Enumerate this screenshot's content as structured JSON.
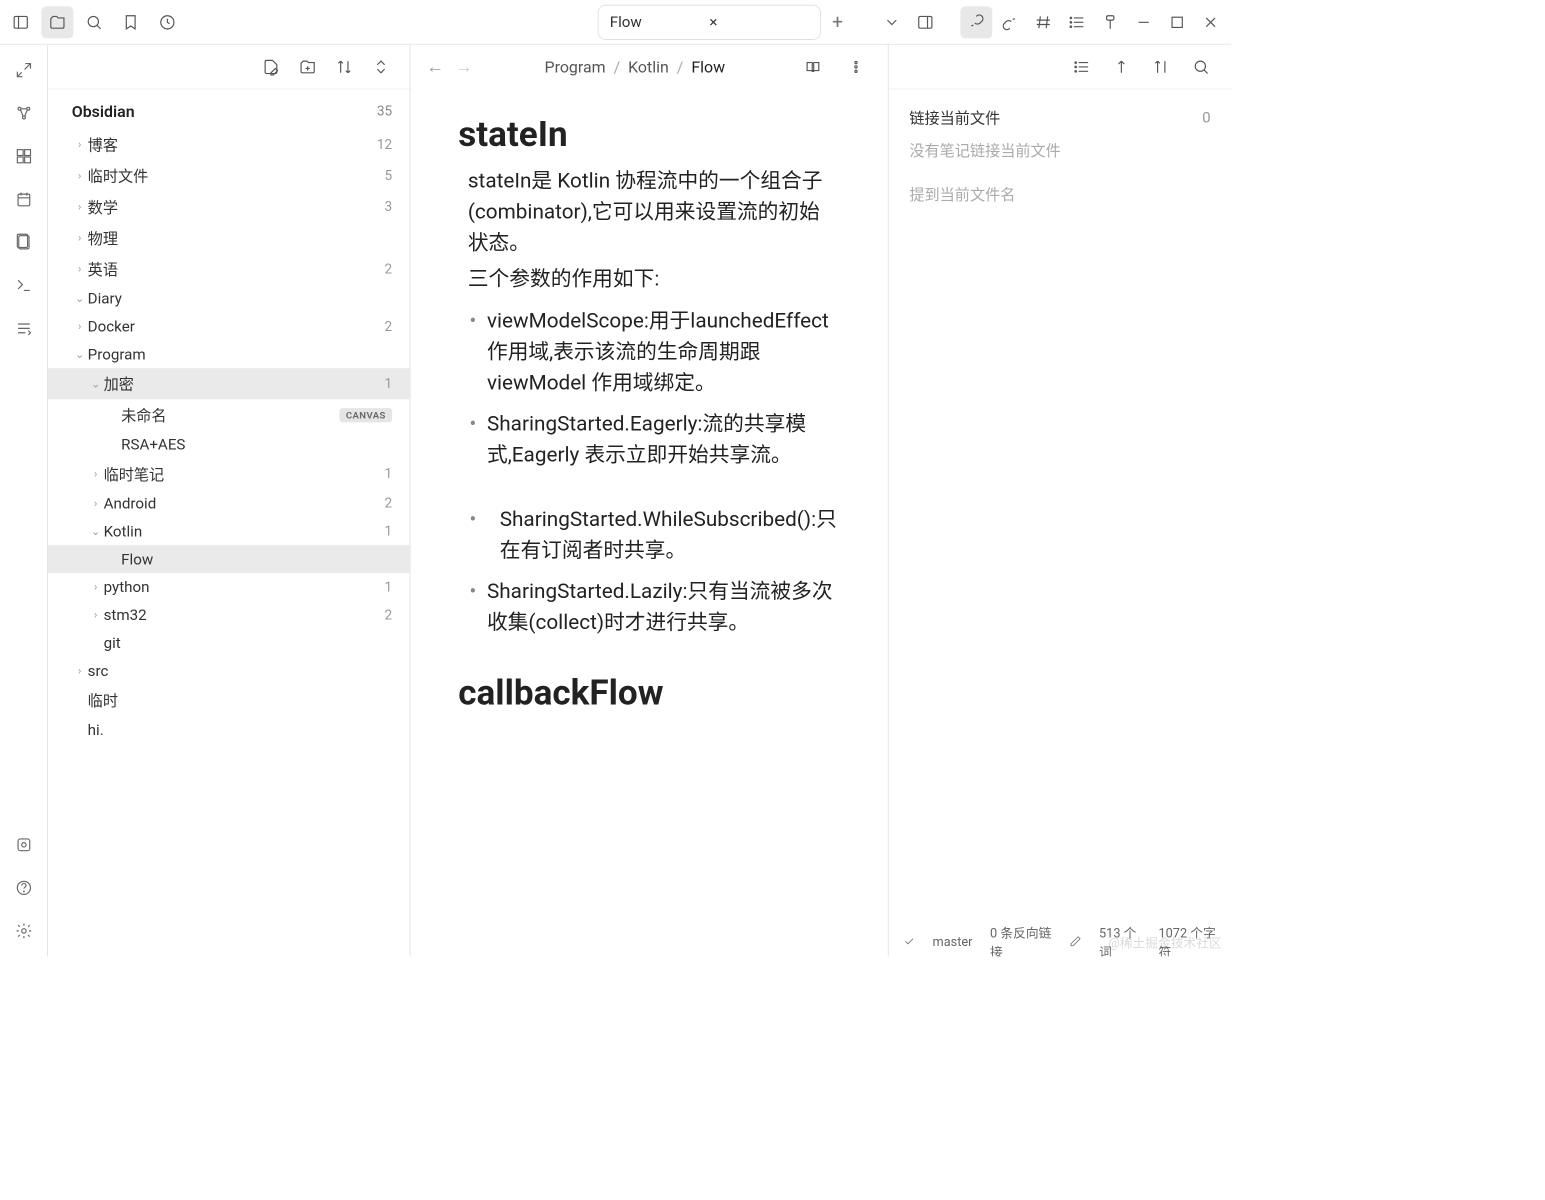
{
  "titlebar": {
    "tab_title": "Flow"
  },
  "sidebar": {
    "vault_name": "Obsidian",
    "vault_count": "35",
    "items": [
      {
        "label": "博客",
        "count": "12",
        "arrow": "›",
        "indent": 0
      },
      {
        "label": "临时文件",
        "count": "5",
        "arrow": "›",
        "indent": 0
      },
      {
        "label": "数学",
        "count": "3",
        "arrow": "›",
        "indent": 0
      },
      {
        "label": "物理",
        "count": "",
        "arrow": "›",
        "indent": 0
      },
      {
        "label": "英语",
        "count": "2",
        "arrow": "›",
        "indent": 0
      },
      {
        "label": "Diary",
        "count": "",
        "arrow": "⌄",
        "indent": 0
      },
      {
        "label": "Docker",
        "count": "2",
        "arrow": "›",
        "indent": 0
      },
      {
        "label": "Program",
        "count": "",
        "arrow": "⌄",
        "indent": 0
      },
      {
        "label": "加密",
        "count": "1",
        "arrow": "⌄",
        "indent": 1,
        "selected": true
      },
      {
        "label": "未命名",
        "count": "",
        "arrow": "",
        "indent": 2,
        "badge": "CANVAS"
      },
      {
        "label": "RSA+AES",
        "count": "",
        "arrow": "",
        "indent": 2
      },
      {
        "label": "临时笔记",
        "count": "1",
        "arrow": "›",
        "indent": 1
      },
      {
        "label": "Android",
        "count": "2",
        "arrow": "›",
        "indent": 1
      },
      {
        "label": "Kotlin",
        "count": "1",
        "arrow": "⌄",
        "indent": 1
      },
      {
        "label": "Flow",
        "count": "",
        "arrow": "",
        "indent": 2,
        "active": true
      },
      {
        "label": "python",
        "count": "1",
        "arrow": "›",
        "indent": 1
      },
      {
        "label": "stm32",
        "count": "2",
        "arrow": "›",
        "indent": 1
      },
      {
        "label": "git",
        "count": "",
        "arrow": "",
        "indent": 1
      },
      {
        "label": "src",
        "count": "",
        "arrow": "›",
        "indent": 0
      },
      {
        "label": "临时",
        "count": "",
        "arrow": "",
        "indent": 0
      },
      {
        "label": "hi.",
        "count": "",
        "arrow": "",
        "indent": 0
      }
    ]
  },
  "breadcrumb": {
    "parts": [
      "Program",
      "Kotlin",
      "Flow"
    ]
  },
  "note": {
    "h1_1": "stateIn",
    "p1": "stateIn是 Kotlin 协程流中的一个组合子(combinator),它可以用来设置流的初始状态。",
    "p2": "三个参数的作用如下:",
    "li1": "viewModelScope:用于launchedEffect 作用域,表示该流的生命周期跟 viewModel 作用域绑定。",
    "li2": "SharingStarted.Eagerly:流的共享模式,Eagerly 表示立即开始共享流。",
    "li3": "SharingStarted.WhileSubscribed():只在有订阅者时共享。",
    "li4": "SharingStarted.Lazily:只有当流被多次收集(collect)时才进行共享。",
    "h1_2": "callbackFlow"
  },
  "rightpanel": {
    "header": "链接当前文件",
    "count": "0",
    "empty": "没有笔记链接当前文件",
    "mention": "提到当前文件名"
  },
  "status": {
    "branch": "master",
    "backlinks": "0 条反向链接",
    "words": "513 个词",
    "chars": "1072 个字符"
  },
  "watermark": "@稀土掘金技术社区"
}
